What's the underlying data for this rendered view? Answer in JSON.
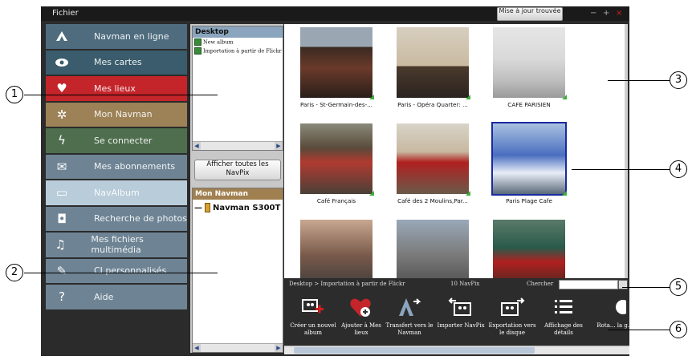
{
  "window": {
    "menu_file": "Fichier",
    "update_button": "Mise à jour trouvée"
  },
  "sidebar": {
    "items": [
      {
        "label": "Navman en ligne",
        "color": "#4e6c7e",
        "icon": "navman-logo-icon"
      },
      {
        "label": "Mes cartes",
        "color": "#3a5c6c",
        "icon": "map-eye-icon"
      },
      {
        "label": "Mes lieux",
        "color": "#c4252a",
        "icon": "heart-icon"
      },
      {
        "label": "Mon Navman",
        "color": "#9c8256",
        "icon": "gear-icon"
      },
      {
        "label": "Se connecter",
        "color": "#4e6e4e",
        "icon": "plug-icon"
      },
      {
        "label": "Mes abonnements",
        "color": "#6e8494",
        "icon": "envelope-icon"
      },
      {
        "label": "NavAlbum",
        "color": "#b9ccd9",
        "icon": "album-icon"
      },
      {
        "label": "Recherche de photos",
        "color": "#6e8494",
        "icon": "camera-icon"
      },
      {
        "label": "Mes fichiers multimédia",
        "color": "#6e8494",
        "icon": "music-note-icon"
      },
      {
        "label": "CI personnalisés",
        "color": "#6e8494",
        "icon": "pencil-icon"
      },
      {
        "label": "Aide",
        "color": "#6e8494",
        "icon": "help-icon"
      }
    ]
  },
  "folders": {
    "title": "Desktop",
    "items": [
      "New album",
      "Importation à partir de Flickr"
    ]
  },
  "show_all_button": "Afficher toutes les NavPix",
  "device_panel": {
    "title": "Mon Navman",
    "device": "Navman S300T ("
  },
  "gallery": {
    "photos": [
      {
        "caption": "Paris - St-Germain-des-..."
      },
      {
        "caption": "Paris - Opéra Quarter: ..."
      },
      {
        "caption": "CAFE PARISIEN"
      },
      {
        "caption": "Café Français"
      },
      {
        "caption": "Café des 2 Moulins,Par..."
      },
      {
        "caption": "Paris Plage Cafe",
        "selected": true
      },
      {
        "caption": ""
      },
      {
        "caption": ""
      },
      {
        "caption": ""
      }
    ]
  },
  "status": {
    "path": "Desktop > Importation à partir de Flickr",
    "count": "10 NavPix",
    "search_label": "Chercher"
  },
  "toolbar": {
    "tools": [
      {
        "label": "Créer un nouvel album",
        "icon": "create-album-icon"
      },
      {
        "label": "Ajouter à Mes lieux",
        "icon": "add-to-places-icon"
      },
      {
        "label": "Transfert vers le Navman",
        "icon": "transfer-to-navman-icon"
      },
      {
        "label": "Importer NavPix",
        "icon": "import-navpix-icon"
      },
      {
        "label": "Exportation vers le disque",
        "icon": "export-disk-icon"
      },
      {
        "label": "Affichage des détails",
        "icon": "details-list-icon"
      },
      {
        "label": "Rota... la g...",
        "icon": "rotate-icon"
      }
    ]
  },
  "callouts": [
    "1",
    "2",
    "3",
    "4",
    "5",
    "6"
  ]
}
